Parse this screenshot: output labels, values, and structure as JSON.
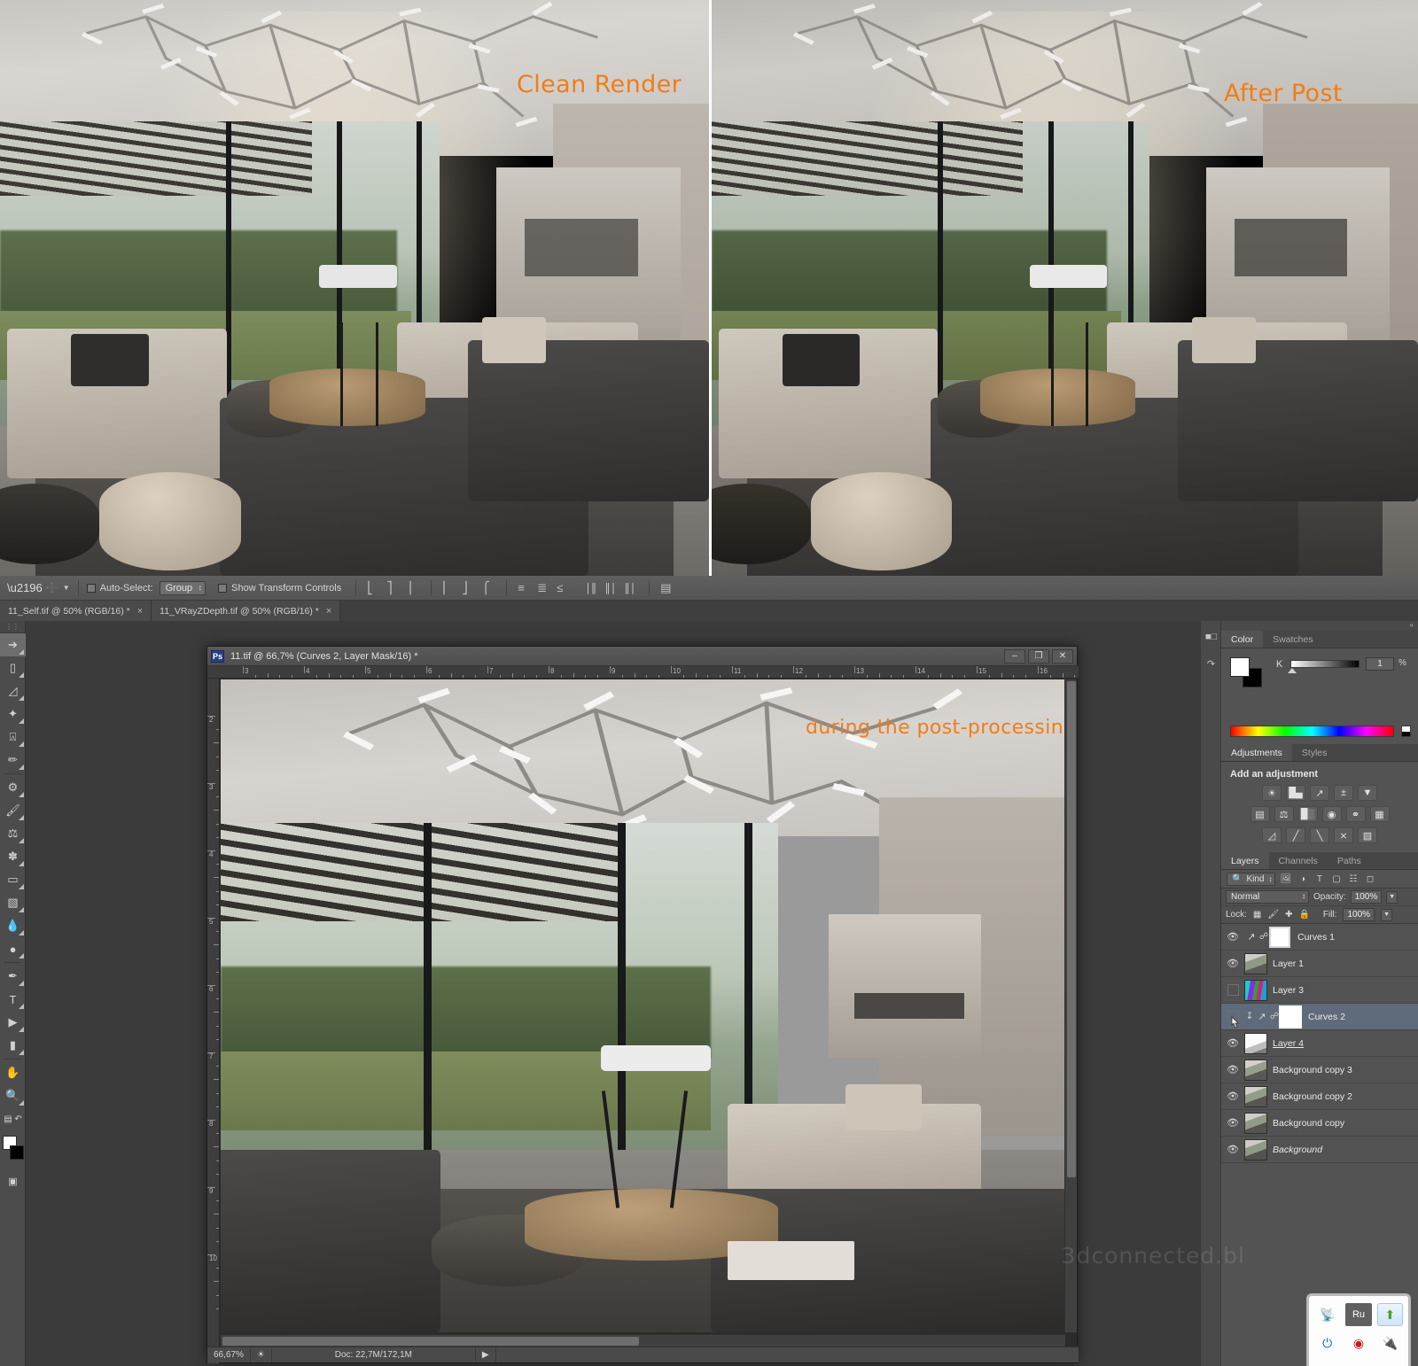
{
  "comparison": {
    "left_label": "Clean Render",
    "right_label": "After Post",
    "annotation_color": "#ef7d1a"
  },
  "photoshop": {
    "options_bar": {
      "move_tool_icon": "move-tool-icon",
      "auto_select_label": "Auto-Select:",
      "auto_select_value": "Group",
      "show_transform_label": "Show Transform Controls"
    },
    "document_tabs": [
      {
        "label": "11_Self.tif @ 50% (RGB/16) *",
        "close": "×",
        "active": false
      },
      {
        "label": "11_VRayZDepth.tif @ 50% (RGB/16) *",
        "close": "×",
        "active": false
      }
    ],
    "tools": [
      "move-tool",
      "rectangular-marquee-tool",
      "lasso-tool",
      "magic-wand-tool",
      "crop-tool",
      "eyedropper-tool",
      "spot-healing-brush-tool",
      "brush-tool",
      "clone-stamp-tool",
      "history-brush-tool",
      "eraser-tool",
      "gradient-tool",
      "blur-tool",
      "dodge-tool",
      "pen-tool",
      "type-tool",
      "path-selection-tool",
      "rectangle-tool",
      "hand-tool",
      "zoom-tool"
    ],
    "document_window": {
      "app_badge": "Ps",
      "title": "11.tif @ 66,7% (Curves 2, Layer Mask/16) *",
      "minimize": "–",
      "maximize": "❐",
      "close": "✕",
      "canvas_annotation": "during the post-processing",
      "ruler_h_ticks": [
        "3",
        "4",
        "5",
        "6",
        "7",
        "8",
        "9",
        "10",
        "11",
        "12",
        "13",
        "14",
        "15",
        "16"
      ],
      "ruler_v_ticks": [
        "2",
        "3",
        "4",
        "5",
        "6",
        "7",
        "8",
        "9",
        "10"
      ],
      "status": {
        "zoom": "66,67%",
        "doc_icon": "doc-size-icon",
        "doc_info": "Doc: 22,7M/172,1M",
        "play_icon": "▶"
      }
    },
    "right_dock": {
      "collapse_icon": "«",
      "rail_icons": [
        "history-icon",
        "actions-icon"
      ],
      "color_panel": {
        "tabs": [
          {
            "label": "Color",
            "active": true
          },
          {
            "label": "Swatches",
            "active": false
          }
        ],
        "channel_label": "K",
        "value": "1",
        "unit": "%",
        "foreground": "#ffffff",
        "background": "#000000"
      },
      "adjustments_panel": {
        "tabs": [
          {
            "label": "Adjustments",
            "active": true
          },
          {
            "label": "Styles",
            "active": false
          }
        ],
        "heading": "Add an adjustment",
        "row1": [
          "brightness-contrast-icon",
          "levels-icon",
          "curves-icon",
          "exposure-icon",
          "vibrance-icon"
        ],
        "row2": [
          "hue-saturation-icon",
          "color-balance-icon",
          "black-white-icon",
          "photo-filter-icon",
          "channel-mixer-icon",
          "color-lookup-icon"
        ],
        "row3": [
          "invert-icon",
          "posterize-icon",
          "threshold-icon",
          "selective-color-icon",
          "gradient-map-icon"
        ]
      },
      "layers_panel": {
        "tabs": [
          {
            "label": "Layers",
            "active": true
          },
          {
            "label": "Channels",
            "active": false
          },
          {
            "label": "Paths",
            "active": false
          }
        ],
        "filter": {
          "search_icon": "search-icon",
          "kind_label": "Kind",
          "filter_icons": [
            "pixel-filter-icon",
            "adjustment-filter-icon",
            "type-filter-icon",
            "shape-filter-icon",
            "smart-object-filter-icon"
          ]
        },
        "blend_mode": "Normal",
        "opacity_label": "Opacity:",
        "opacity_value": "100%",
        "lock_label": "Lock:",
        "lock_icons": [
          "lock-transparent-icon",
          "lock-image-icon",
          "lock-position-icon",
          "lock-all-icon"
        ],
        "fill_label": "Fill:",
        "fill_value": "100%",
        "layers": [
          {
            "name": "Curves 1",
            "visible": true,
            "selected": false,
            "type": "adjustment",
            "has_mask": true,
            "clipped": false,
            "italic": false,
            "underline": false,
            "thumb": ""
          },
          {
            "name": "Layer 1",
            "visible": true,
            "selected": false,
            "type": "pixel",
            "has_mask": false,
            "clipped": false,
            "italic": false,
            "underline": false,
            "thumb": "interior"
          },
          {
            "name": "Layer 3",
            "visible": false,
            "selected": false,
            "type": "pixel",
            "has_mask": false,
            "clipped": false,
            "italic": false,
            "underline": false,
            "thumb": "multimatte"
          },
          {
            "name": "Curves 2",
            "visible": false,
            "selected": true,
            "type": "adjustment",
            "has_mask": true,
            "clipped": true,
            "italic": false,
            "underline": false,
            "thumb": ""
          },
          {
            "name": "Layer 4",
            "visible": true,
            "selected": false,
            "type": "pixel",
            "has_mask": false,
            "clipped": false,
            "italic": false,
            "underline": true,
            "thumb": "zdepth"
          },
          {
            "name": "Background copy 3",
            "visible": true,
            "selected": false,
            "type": "pixel",
            "has_mask": false,
            "clipped": false,
            "italic": false,
            "underline": false,
            "thumb": "interior"
          },
          {
            "name": "Background copy 2",
            "visible": true,
            "selected": false,
            "type": "pixel",
            "has_mask": false,
            "clipped": false,
            "italic": false,
            "underline": false,
            "thumb": "interior"
          },
          {
            "name": "Background copy",
            "visible": true,
            "selected": false,
            "type": "pixel",
            "has_mask": false,
            "clipped": false,
            "italic": false,
            "underline": false,
            "thumb": "interior"
          },
          {
            "name": "Background",
            "visible": true,
            "selected": false,
            "type": "pixel",
            "has_mask": false,
            "clipped": false,
            "italic": true,
            "underline": false,
            "thumb": "interior"
          }
        ]
      }
    },
    "watermark": "3dconnected.bl",
    "system_tray": {
      "icons": [
        "bluetooth-device-icon",
        "ru-language-icon",
        "safely-remove-icon",
        "power-icon",
        "antivirus-icon",
        "usb-plug-icon"
      ],
      "language_label": "Ru"
    }
  }
}
